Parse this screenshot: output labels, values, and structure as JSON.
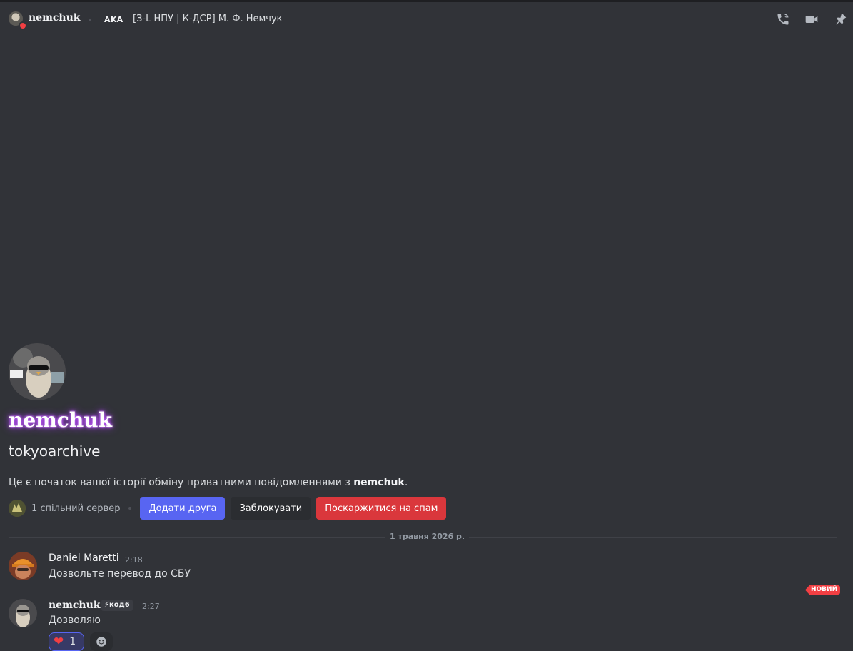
{
  "header": {
    "username": "nemchuk",
    "aka_label": "AKA",
    "nickname": "[З-L НПУ | К-ДСР] М. Ф. Немчук",
    "icons": [
      "phone-call-icon",
      "video-call-icon",
      "pin-icon"
    ]
  },
  "intro": {
    "display_name": "nemchuk",
    "username": "tokyoarchive",
    "text_prefix": "Це є початок вашої історії обміну приватними повідомленнями з ",
    "text_name": "nemchuk",
    "text_suffix": ".",
    "mutual_servers": "1 спільний сервер",
    "add_friend": "Додати друга",
    "block": "Заблокувати",
    "report_spam": "Поскаржитися на спам"
  },
  "date_divider": "1 травня 2026 р.",
  "messages": [
    {
      "author": "Daniel Maretti",
      "time": "2:18",
      "text": "Дозвольте перевод до СБУ"
    },
    {
      "author": "nemchuk",
      "tag": "⚡код6",
      "time": "2:27",
      "text": "Дозволяю"
    }
  ],
  "new_badge": "НОВИЙ",
  "reaction": {
    "emoji": "❤",
    "count": "1"
  },
  "colors": {
    "accent": "#5865f2",
    "danger": "#da373c",
    "new_line": "#f23f43",
    "background": "#313338"
  }
}
